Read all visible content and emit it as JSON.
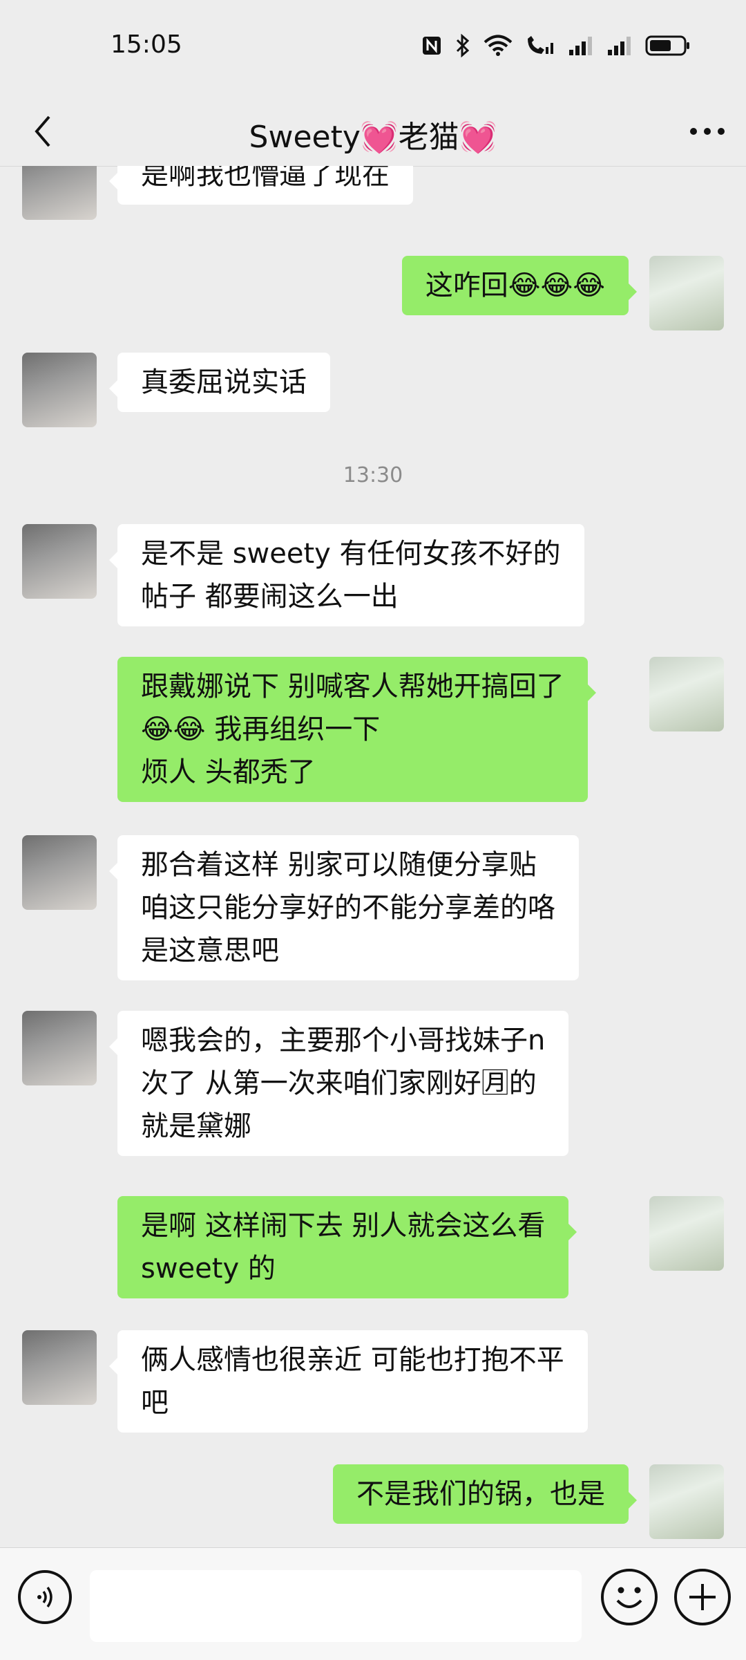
{
  "status_bar": {
    "time": "15:05",
    "icons": [
      "nfc-icon",
      "bluetooth-icon",
      "wifi-icon",
      "volte-call-icon",
      "signal-icon",
      "signal-icon",
      "battery-icon"
    ]
  },
  "header": {
    "title": "Sweety💓老猫💓",
    "back_icon": "chevron-left-icon",
    "more_icon": "more-dots-icon"
  },
  "messages": [
    {
      "side": "in",
      "avatar": "cat-avatar",
      "text": "是啊我也懵逼了现在"
    },
    {
      "side": "out",
      "avatar": "flower-avatar",
      "text": "这咋回😂😂😂"
    },
    {
      "side": "in",
      "avatar": "cat-avatar",
      "text": "真委屈说实话"
    },
    {
      "type": "time",
      "text": "13:30"
    },
    {
      "side": "in",
      "avatar": "cat-avatar",
      "text": "是不是 sweety 有任何女孩不好的\n帖子 都要闹这么一出"
    },
    {
      "side": "out",
      "avatar": "flower-avatar",
      "text": "跟戴娜说下 别喊客人帮她开搞回了\n😂😂 我再组织一下\n烦人 头都秃了"
    },
    {
      "side": "in",
      "avatar": "cat-avatar",
      "text": "那合着这样 别家可以随便分享贴\n咱这只能分享好的不能分享差的咯\n是这意思吧"
    },
    {
      "side": "in",
      "avatar": "cat-avatar",
      "text": "嗯我会的，主要那个小哥找妹子n\n次了 从第一次来咱们家刚好🈷的\n就是黛娜"
    },
    {
      "side": "out",
      "avatar": "flower-avatar",
      "text": "是啊 这样闹下去 别人就会这么看\nsweety 的"
    },
    {
      "side": "in",
      "avatar": "cat-avatar",
      "text": "俩人感情也很亲近 可能也打抱不平\n吧"
    },
    {
      "side": "out",
      "avatar": "flower-avatar",
      "text": "不是我们的锅，也是"
    }
  ],
  "input_bar": {
    "voice_icon": "voice-icon",
    "input_value": "",
    "emoji_icon": "emoji-icon",
    "plus_icon": "plus-icon"
  },
  "colors": {
    "background": "#ededed",
    "outgoing_bubble": "#95ec69",
    "incoming_bubble": "#ffffff",
    "timestamp_text": "#8b8b8b"
  }
}
